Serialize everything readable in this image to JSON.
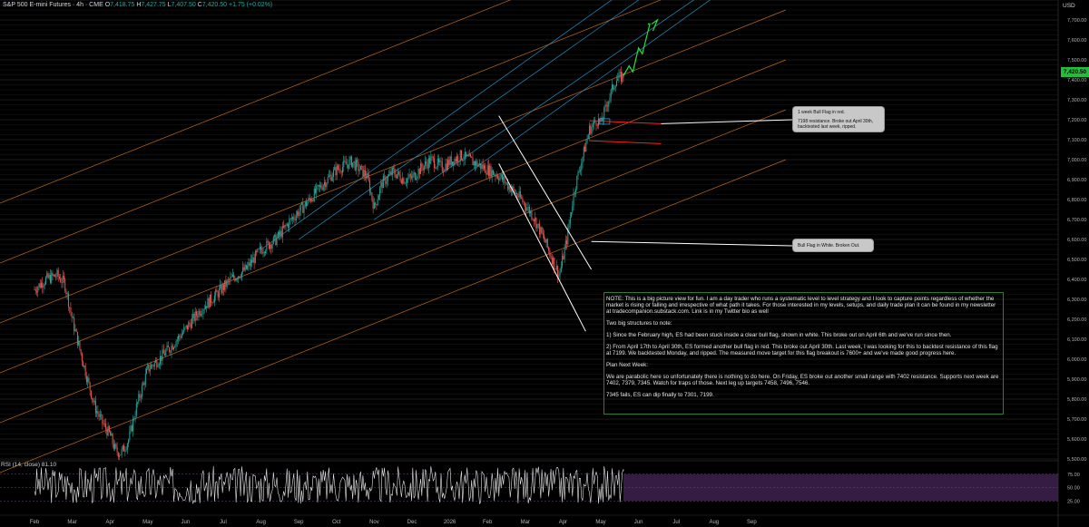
{
  "header": {
    "symbol": "S&P 500 E-mini Futures · 4h · CME",
    "open_label": "O",
    "open": "7,418.75",
    "high_label": "H",
    "high": "7,427.75",
    "low_label": "L",
    "low": "7,407.50",
    "close_label": "C",
    "close": "7,420.50",
    "change": "+1.75 (+0.02%)"
  },
  "currency": "USD",
  "current_price": "7,420.50",
  "rsi_label": "RSI (14, close)  81.10",
  "callouts": {
    "bull_flag_red_title": "1 week Bull Flag in red.",
    "bull_flag_red_body": "7198 resistance. Broke out April 30th, backtested last week, ripped.",
    "bull_flag_white": "Bull Flag in White. Broken Out."
  },
  "note": {
    "p1": "NOTE: This is a big picture view for fun. I am a day trader who runs a systematic level to level strategy and I look to capture points regardless of whether the market is rising or falling and irrespective of what path it takes. For those interested in my levels, setups, and daily trade plan it can be found in my newsletter at tradecompanion.substack.com. Link is in my Twitter bio as well",
    "p2": "Two big structures to note:",
    "p3": "1) Since the February high, ES had been stuck inside a clear bull flag, shown in white. This broke out on April 6th and we've run since then.",
    "p4": "2) From April 17th to April 30th, ES formed another bull flag in red. This broke out April 30th. Last week, I was looking for this to backtest resistance of this flag at 7199. We backtested Monday, and ripped. The measured move target for this flag breakout is 7600+ and we've made good progress here.",
    "p5": "Plan Next Week:",
    "p6": "We are parabolic here so unfortunately there is nothing to do here. On Friday, ES broke out another small range with 7402 resistance. Supports next week are 7402, 7379, 7345. Watch for traps of those. Next leg up targets 7458, 7496, 7546.",
    "p7": "7345 fails, ES can dip finally to 7301, 7199."
  },
  "colors": {
    "background": "#000000",
    "candle_up": "#26a69a",
    "candle_down": "#ef5350",
    "channel_orange": "#e07b1c",
    "channel_blue": "#29a8e0",
    "flag_white": "#ffffff",
    "flag_red": "#ff2020",
    "projection_green": "#20e040",
    "rsi_line": "#e6e6e6",
    "rsi_band": "#3a1f4a"
  },
  "chart_data": {
    "type": "line",
    "title": "S&P 500 E-mini Futures · 4h · CME",
    "xlabel": "",
    "ylabel": "",
    "ylim": [
      5500,
      7800
    ],
    "yticks": [
      5500,
      5600,
      5700,
      5800,
      5900,
      6000,
      6100,
      6200,
      6300,
      6400,
      6500,
      6600,
      6700,
      6800,
      6900,
      7000,
      7100,
      7200,
      7300,
      7400,
      7500,
      7600,
      7700
    ],
    "ytick_labels": [
      "5,500.00",
      "5,600.00",
      "5,700.00",
      "5,800.00",
      "5,900.00",
      "6,000.00",
      "6,100.00",
      "6,200.00",
      "6,300.00",
      "6,400.00",
      "6,500.00",
      "6,600.00",
      "6,700.00",
      "6,800.00",
      "6,900.00",
      "7,000.00",
      "7,100.00",
      "7,200.00",
      "7,300.00",
      "7,400.00",
      "7,500.00",
      "7,600.00",
      "7,700.00"
    ],
    "x_labels": [
      "Feb",
      "Mar",
      "Apr",
      "May",
      "Jun",
      "Jul",
      "Aug",
      "Sep",
      "Oct",
      "Nov",
      "Dec",
      "2026",
      "Feb",
      "Mar",
      "Apr",
      "May",
      "Jun",
      "Jul",
      "Aug",
      "Sep"
    ],
    "x_label_index": [
      0,
      1,
      2,
      3,
      4,
      5,
      6,
      7,
      8,
      9,
      10,
      11,
      12,
      13,
      14,
      15,
      16,
      17,
      18,
      19
    ],
    "x_units": "months (0 = Feb 2025)",
    "xlim": [
      -0.1,
      19.9
    ],
    "series": [
      {
        "x": [
          0.0,
          0.3,
          0.6,
          0.8,
          1.0,
          1.2,
          1.4,
          1.6,
          1.8,
          2.0,
          2.15,
          2.3,
          2.5,
          2.7,
          3.0,
          3.3,
          3.6,
          4.0,
          4.4,
          4.8,
          5.2,
          5.6,
          6.0,
          6.4,
          6.8,
          7.2,
          7.6,
          8.0,
          8.4,
          8.8,
          9.0,
          9.2,
          9.5,
          9.8,
          10.0,
          10.2,
          10.5,
          10.8,
          11.0,
          11.3,
          11.6,
          12.0,
          12.3,
          12.6,
          12.9,
          13.2,
          13.5,
          13.7,
          13.9,
          14.1,
          14.3,
          14.5,
          14.7,
          14.9,
          15.0,
          15.2,
          15.4,
          15.6
        ],
        "values": [
          6350,
          6400,
          6420,
          6380,
          6200,
          6050,
          5900,
          5760,
          5680,
          5620,
          5540,
          5530,
          5600,
          5760,
          5950,
          6000,
          6060,
          6150,
          6250,
          6320,
          6400,
          6450,
          6550,
          6600,
          6700,
          6780,
          6870,
          6950,
          6990,
          6920,
          6760,
          6880,
          6940,
          6900,
          6910,
          6950,
          7000,
          6960,
          6990,
          7020,
          6990,
          6950,
          6920,
          6860,
          6800,
          6720,
          6600,
          6510,
          6420,
          6600,
          6850,
          7000,
          7150,
          7200,
          7180,
          7300,
          7400,
          7420
        ]
      }
    ],
    "rsi": {
      "label": "RSI (14, close)",
      "value": 81.1,
      "ylim": [
        0,
        100
      ],
      "levels": [
        25,
        50,
        75
      ],
      "level_labels": [
        "25.00",
        "50.00",
        "75.00"
      ]
    },
    "annotations": [
      {
        "type": "flag",
        "color": "white",
        "label": "Bull Flag in White. Broken Out."
      },
      {
        "type": "flag",
        "color": "red",
        "label": "1 week Bull Flag in red. 7198 resistance. Broke out April 30th, backtested last week, ripped.",
        "resistance": 7198
      }
    ]
  }
}
